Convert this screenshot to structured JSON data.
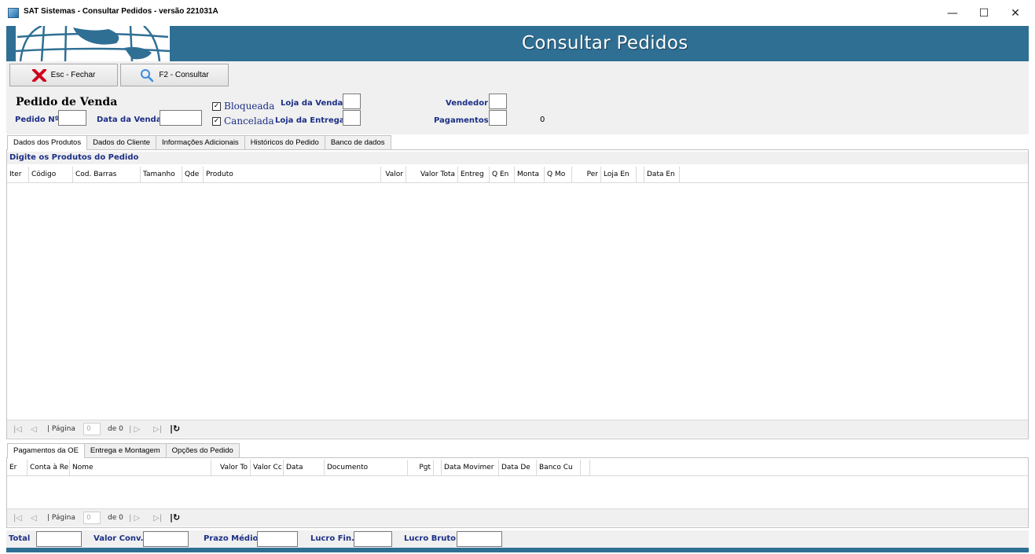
{
  "window": {
    "title": "SAT Sistemas - Consultar Pedidos - versão 221031A",
    "minimize": "—",
    "maximize": "☐",
    "close": "✕"
  },
  "banner": {
    "title": "Consultar Pedidos"
  },
  "toolbar": {
    "close_label": "Esc - Fechar",
    "consult_label": "F2 - Consultar"
  },
  "header": {
    "section_title": "Pedido de Venda",
    "order_no_label": "Pedido Nº",
    "sale_date_label": "Data da Venda",
    "blocked_label": "Bloqueada",
    "cancelled_label": "Cancelada",
    "store_sale_label": "Loja da Venda",
    "store_delivery_label": "Loja da Entrega",
    "seller_label": "Vendedor",
    "payments_label": "Pagamentos",
    "payments_count": "0",
    "blocked_checked": true,
    "cancelled_checked": true
  },
  "main_tabs": [
    {
      "label": "Dados dos Produtos"
    },
    {
      "label": "Dados do Cliente"
    },
    {
      "label": "Informações Adicionais"
    },
    {
      "label": "Históricos do Pedido"
    },
    {
      "label": "Banco de dados"
    }
  ],
  "products": {
    "caption": "Digite os Produtos do Pedido",
    "columns": [
      "Iter",
      "Código",
      "Cod. Barras",
      "Tamanho",
      "Qde",
      "Produto",
      "Valor",
      "Valor Tota",
      "Entreg",
      "Q En",
      "Monta",
      "Q Mo",
      "Per",
      "Loja En",
      "",
      "Data En"
    ]
  },
  "pager": {
    "first": "|◁",
    "prev": "◁",
    "page_label": "| Página",
    "page_value": "0",
    "of_label": "de 0",
    "next": "| ▷",
    "last": "▷|",
    "refresh": "|↻"
  },
  "bottom_tabs": [
    {
      "label": "Pagamentos da OE"
    },
    {
      "label": "Entrega e Montagem"
    },
    {
      "label": "Opções do Pedido"
    }
  ],
  "payments": {
    "columns": [
      "Er",
      "Conta à Re",
      "Nome",
      "Valor To",
      "Valor Cc",
      "Data",
      "Documento",
      "Pgt",
      "",
      "Data Movimer",
      "Data De",
      "Banco Cu",
      ""
    ]
  },
  "footer": {
    "total_label": "Total",
    "conv_label": "Valor Conv.",
    "prazo_label": "Prazo Médio",
    "lucro_fin_label": "Lucro Fin.",
    "lucro_bruto_label": "Lucro Bruto"
  },
  "colors": {
    "banner": "#2f6f94",
    "label_blue": "#1c2f86",
    "close_red": "#d0021b",
    "search_blue": "#3b8de0"
  }
}
